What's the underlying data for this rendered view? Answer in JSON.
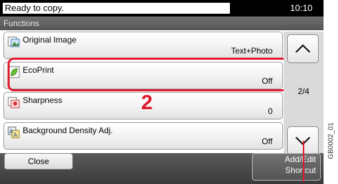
{
  "status": {
    "message": "Ready to copy.",
    "time": "10:10"
  },
  "title": "Functions",
  "items": [
    {
      "label": "Original Image",
      "value": "Text+Photo",
      "icon": "original-image-icon"
    },
    {
      "label": "EcoPrint",
      "value": "Off",
      "icon": "ecoprint-leaf-icon"
    },
    {
      "label": "Sharpness",
      "value": "0",
      "icon": "sharpness-icon"
    },
    {
      "label": "Background Density Adj.",
      "value": "Off",
      "icon": "background-density-icon"
    }
  ],
  "pager": {
    "page": "2/4"
  },
  "callout": {
    "number": "2"
  },
  "buttons": {
    "close": "Close",
    "shortcut_line1": "Add/Edit",
    "shortcut_line2": "Shortcut"
  },
  "figure_code": "GB0002_01",
  "colors": {
    "accent": "#e0182d",
    "statusbar": "#000000",
    "titlebar": "#5f5f5f"
  }
}
